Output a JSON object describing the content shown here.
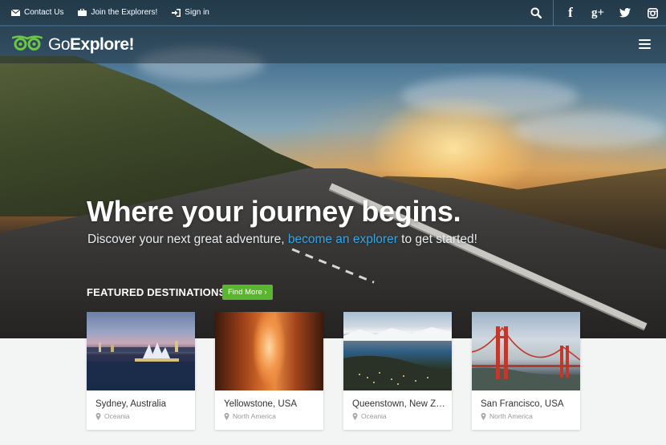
{
  "topbar": {
    "links": [
      {
        "label": "Contact Us",
        "icon": "envelope-icon"
      },
      {
        "label": "Join the Explorers!",
        "icon": "briefcase-icon"
      },
      {
        "label": "Sign in",
        "icon": "sign-in-icon"
      }
    ],
    "social": [
      {
        "icon": "search-icon",
        "glyph": "⌕"
      },
      {
        "icon": "facebook-icon",
        "glyph": "f"
      },
      {
        "icon": "google-plus-icon",
        "glyph": "g+"
      },
      {
        "icon": "twitter-icon",
        "glyph": "t"
      },
      {
        "icon": "instagram-icon",
        "glyph": "◎"
      }
    ]
  },
  "nav": {
    "logo_light": "Go",
    "logo_bold": "Explore!",
    "logo_icon": "owl-eyes-icon",
    "menu_icon": "hamburger-menu-icon"
  },
  "hero": {
    "headline": "Where your journey begins.",
    "sub_before": "Discover your next great adventure, ",
    "sub_link": "become an explorer",
    "sub_after": " to get started!"
  },
  "featured": {
    "title": "FEATURED DESTINATIONS",
    "button": "Find More ›"
  },
  "destinations": [
    {
      "title": "Sydney, Australia",
      "region": "Oceania"
    },
    {
      "title": "Yellowstone, USA",
      "region": "North America"
    },
    {
      "title": "Queenstown, New Zealand",
      "region": "Oceania"
    },
    {
      "title": "San Francisco, USA",
      "region": "North America"
    }
  ],
  "colors": {
    "accent_green": "#5bb62f",
    "link_blue": "#2fa6ea",
    "logo_green": "#6cc644"
  }
}
